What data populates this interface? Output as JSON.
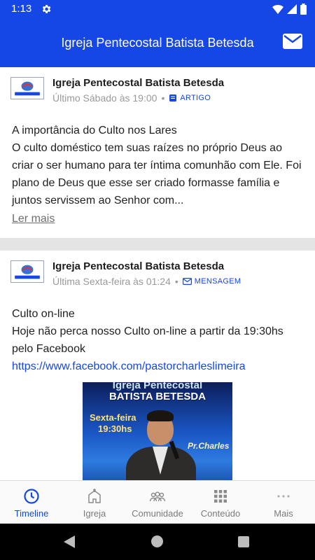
{
  "status_bar": {
    "time": "1:13"
  },
  "header": {
    "title": "Igreja Pentecostal Batista Betesda"
  },
  "colors": {
    "primary": "#1547e6",
    "divider": "#e4e4e4",
    "muted": "#9a9a9a"
  },
  "posts": [
    {
      "author": "Igreja Pentecostal Batista Betesda",
      "logo_text": "BATISTA BETESDA",
      "time": "Último Sábado às 19:00",
      "tag": "ARTIGO",
      "tag_icon": "article-icon",
      "title": "A importância do Culto nos Lares",
      "text": "O culto doméstico tem suas raízes no próprio Deus ao criar o ser humano para ter íntima comunhão com Ele. Foi plano de Deus que esse ser criado formasse família e juntos servissem ao Senhor com...",
      "read_more": "Ler mais"
    },
    {
      "author": "Igreja Pentecostal Batista Betesda",
      "logo_text": "BATISTA BETESDA",
      "time": "Última Sexta-feira às 01:24",
      "tag": "MENSAGEM",
      "tag_icon": "mail-icon",
      "title": "Culto on-line",
      "text": "Hoje não perca nosso Culto on-line a partir da 19:30hs pelo Facebook",
      "link": "https://www.facebook.com/pastorcharleslimeira",
      "image": {
        "line1": "Igreja Pentecostal",
        "line2": "BATISTA BETESDA",
        "day": "Sexta-feira",
        "hour": "19:30hs",
        "name": "Pr.Charles"
      }
    }
  ],
  "bottom_nav": [
    {
      "label": "Timeline",
      "icon": "clock-icon",
      "active": true
    },
    {
      "label": "Igreja",
      "icon": "church-icon",
      "active": false
    },
    {
      "label": "Comunidade",
      "icon": "people-icon",
      "active": false
    },
    {
      "label": "Conteúdo",
      "icon": "grid-icon",
      "active": false
    },
    {
      "label": "Mais",
      "icon": "more-icon",
      "active": false
    }
  ]
}
